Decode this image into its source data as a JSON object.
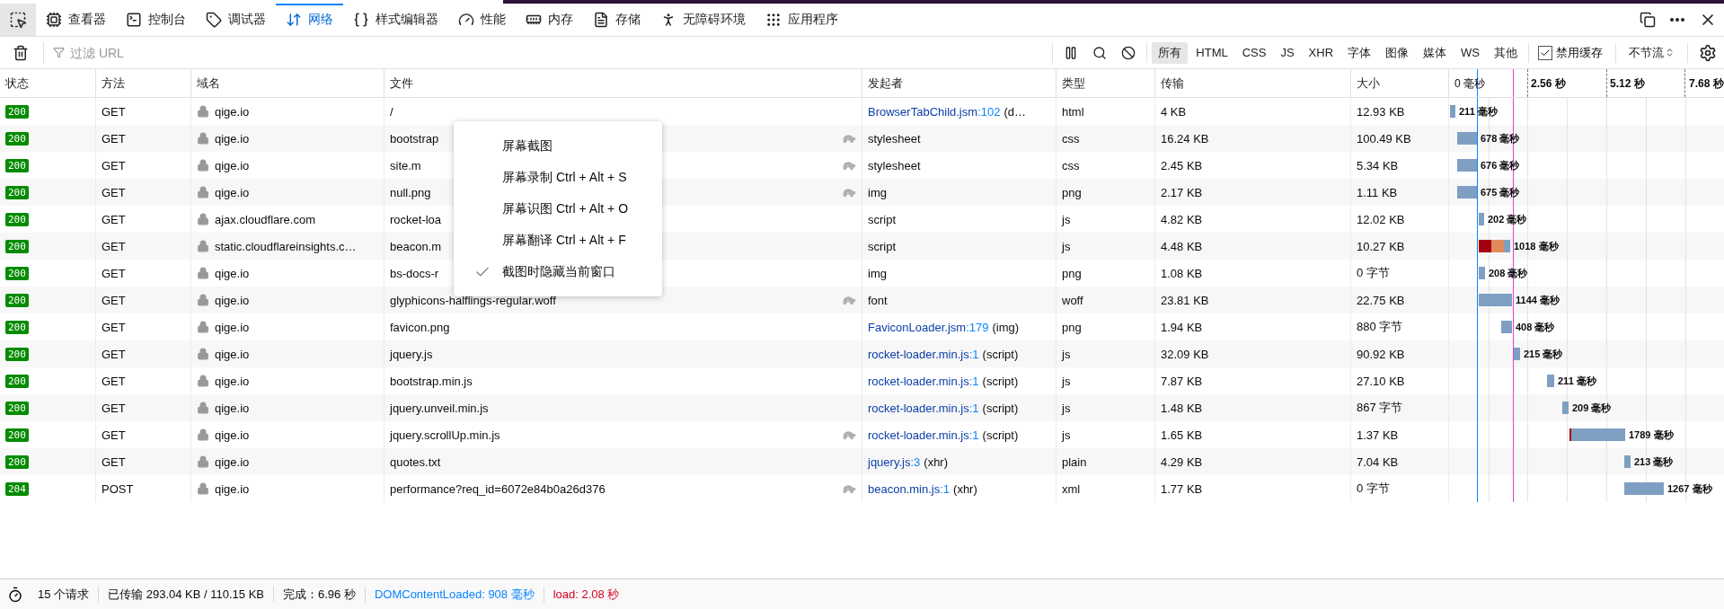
{
  "tabs": [
    {
      "label": "查看器",
      "selected": false
    },
    {
      "label": "控制台",
      "selected": false
    },
    {
      "label": "调试器",
      "selected": false
    },
    {
      "label": "网络",
      "selected": true
    },
    {
      "label": "样式编辑器",
      "selected": false
    },
    {
      "label": "性能",
      "selected": false
    },
    {
      "label": "内存",
      "selected": false
    },
    {
      "label": "存储",
      "selected": false
    },
    {
      "label": "无障碍环境",
      "selected": false
    },
    {
      "label": "应用程序",
      "selected": false
    }
  ],
  "filter": {
    "placeholder": "过滤 URL"
  },
  "type_filters": [
    {
      "label": "所有",
      "selected": true
    },
    {
      "label": "HTML",
      "selected": false
    },
    {
      "label": "CSS",
      "selected": false
    },
    {
      "label": "JS",
      "selected": false
    },
    {
      "label": "XHR",
      "selected": false
    },
    {
      "label": "字体",
      "selected": false
    },
    {
      "label": "图像",
      "selected": false
    },
    {
      "label": "媒体",
      "selected": false
    },
    {
      "label": "WS",
      "selected": false
    },
    {
      "label": "其他",
      "selected": false
    }
  ],
  "disable_cache": {
    "label": "禁用缓存",
    "checked": true
  },
  "throttling": {
    "label": "不节流"
  },
  "columns": [
    "状态",
    "方法",
    "域名",
    "文件",
    "发起者",
    "类型",
    "传输",
    "大小"
  ],
  "timeline_ticks": [
    "0 毫秒",
    "2.56 秒",
    "5.12 秒",
    "7.68 秒"
  ],
  "rows": [
    {
      "status": "200",
      "method": "GET",
      "domain": "qige.io",
      "file": "/",
      "initiator": {
        "kind": "link",
        "file": "BrowserTabChild.jsm",
        "line": ":102",
        "note": "(d…"
      },
      "type": "html",
      "transfer": "4 KB",
      "size": "12.93 KB",
      "time": "211 毫秒",
      "slow": false
    },
    {
      "status": "200",
      "method": "GET",
      "domain": "qige.io",
      "file": "bootstrap",
      "initiator": {
        "kind": "plain",
        "text": "stylesheet"
      },
      "type": "css",
      "transfer": "16.24 KB",
      "size": "100.49 KB",
      "time": "678 毫秒",
      "slow": true
    },
    {
      "status": "200",
      "method": "GET",
      "domain": "qige.io",
      "file": "site.m",
      "initiator": {
        "kind": "plain",
        "text": "stylesheet"
      },
      "type": "css",
      "transfer": "2.45 KB",
      "size": "5.34 KB",
      "time": "676 毫秒",
      "slow": true
    },
    {
      "status": "200",
      "method": "GET",
      "domain": "qige.io",
      "file": "null.png",
      "initiator": {
        "kind": "plain",
        "text": "img"
      },
      "type": "png",
      "transfer": "2.17 KB",
      "size": "1.11 KB",
      "time": "675 毫秒",
      "slow": true
    },
    {
      "status": "200",
      "method": "GET",
      "domain": "ajax.cloudflare.com",
      "file": "rocket-loa",
      "initiator": {
        "kind": "plain",
        "text": "script"
      },
      "type": "js",
      "transfer": "4.82 KB",
      "size": "12.02 KB",
      "time": "202 毫秒",
      "slow": false
    },
    {
      "status": "200",
      "method": "GET",
      "domain": "static.cloudflareinsights.c…",
      "file": "beacon.m",
      "initiator": {
        "kind": "plain",
        "text": "script"
      },
      "type": "js",
      "transfer": "4.48 KB",
      "size": "10.27 KB",
      "time": "1018 毫秒",
      "slow": false
    },
    {
      "status": "200",
      "method": "GET",
      "domain": "qige.io",
      "file": "bs-docs-r",
      "initiator": {
        "kind": "plain",
        "text": "img"
      },
      "type": "png",
      "transfer": "1.08 KB",
      "size": "0 字节",
      "time": "208 毫秒",
      "slow": false
    },
    {
      "status": "200",
      "method": "GET",
      "domain": "qige.io",
      "file": "glyphicons-halflings-regular.woff",
      "initiator": {
        "kind": "plain",
        "text": "font"
      },
      "type": "woff",
      "transfer": "23.81 KB",
      "size": "22.75 KB",
      "time": "1144 毫秒",
      "slow": true
    },
    {
      "status": "200",
      "method": "GET",
      "domain": "qige.io",
      "file": "favicon.png",
      "initiator": {
        "kind": "link",
        "file": "FaviconLoader.jsm",
        "line": ":179",
        "note": "(img)"
      },
      "type": "png",
      "transfer": "1.94 KB",
      "size": "880 字节",
      "time": "408 毫秒",
      "slow": false
    },
    {
      "status": "200",
      "method": "GET",
      "domain": "qige.io",
      "file": "jquery.js",
      "initiator": {
        "kind": "link",
        "file": "rocket-loader.min.js",
        "line": ":1",
        "note": "(script)"
      },
      "type": "js",
      "transfer": "32.09 KB",
      "size": "90.92 KB",
      "time": "215 毫秒",
      "slow": false
    },
    {
      "status": "200",
      "method": "GET",
      "domain": "qige.io",
      "file": "bootstrap.min.js",
      "initiator": {
        "kind": "link",
        "file": "rocket-loader.min.js",
        "line": ":1",
        "note": "(script)"
      },
      "type": "js",
      "transfer": "7.87 KB",
      "size": "27.10 KB",
      "time": "211 毫秒",
      "slow": false
    },
    {
      "status": "200",
      "method": "GET",
      "domain": "qige.io",
      "file": "jquery.unveil.min.js",
      "initiator": {
        "kind": "link",
        "file": "rocket-loader.min.js",
        "line": ":1",
        "note": "(script)"
      },
      "type": "js",
      "transfer": "1.48 KB",
      "size": "867 字节",
      "time": "209 毫秒",
      "slow": false
    },
    {
      "status": "200",
      "method": "GET",
      "domain": "qige.io",
      "file": "jquery.scrollUp.min.js",
      "initiator": {
        "kind": "link",
        "file": "rocket-loader.min.js",
        "line": ":1",
        "note": "(script)"
      },
      "type": "js",
      "transfer": "1.65 KB",
      "size": "1.37 KB",
      "time": "1789 毫秒",
      "slow": true
    },
    {
      "status": "200",
      "method": "GET",
      "domain": "qige.io",
      "file": "quotes.txt",
      "initiator": {
        "kind": "link",
        "file": "jquery.js",
        "line": ":3",
        "note": "(xhr)"
      },
      "type": "plain",
      "transfer": "4.29 KB",
      "size": "7.04 KB",
      "time": "213 毫秒",
      "slow": false
    },
    {
      "status": "204",
      "method": "POST",
      "domain": "qige.io",
      "file": "performance?req_id=6072e84b0a26d376",
      "initiator": {
        "kind": "link",
        "file": "beacon.min.js",
        "line": ":1",
        "note": "(xhr)"
      },
      "type": "xml",
      "transfer": "1.77 KB",
      "size": "0 字节",
      "time": "1267 毫秒",
      "slow": true
    }
  ],
  "context_menu": [
    {
      "label": "屏幕截图",
      "checked": false
    },
    {
      "label": "屏幕录制 Ctrl + Alt + S",
      "checked": false
    },
    {
      "label": "屏幕识图 Ctrl + Alt + O",
      "checked": false
    },
    {
      "label": "屏幕翻译 Ctrl + Alt + F",
      "checked": false
    },
    {
      "label": "截图时隐藏当前窗口",
      "checked": true
    }
  ],
  "status_bar": [
    {
      "kind": "plain",
      "text": "15 个请求"
    },
    {
      "kind": "plain",
      "text": "已传输 293.04 KB / 110.15 KB"
    },
    {
      "kind": "plain",
      "text": "完成：6.96 秒"
    },
    {
      "kind": "dom",
      "text": "DOMContentLoaded: 908 毫秒"
    },
    {
      "kind": "load",
      "text": "load: 2.08 秒"
    }
  ]
}
